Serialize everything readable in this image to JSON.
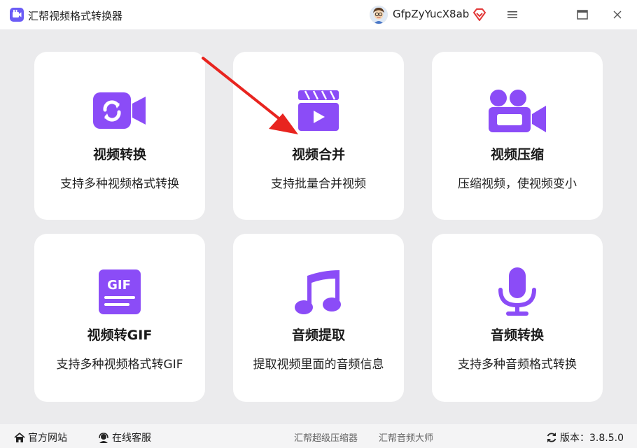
{
  "window": {
    "title": "汇帮视频格式转换器",
    "username": "GfpZyYucX8ab"
  },
  "colors": {
    "accent": "#8b4cf7",
    "arrow": "#e8241f",
    "background": "#ebebed"
  },
  "cards": [
    {
      "title": "视频转换",
      "desc": "支持多种视频格式转换",
      "icon": "video-convert-icon"
    },
    {
      "title": "视频合并",
      "desc": "支持批量合并视频",
      "icon": "clapperboard-icon"
    },
    {
      "title": "视频压缩",
      "desc": "压缩视频，使视频变小",
      "icon": "video-camera-icon"
    },
    {
      "title": "视频转GIF",
      "desc": "支持多种视频格式转GIF",
      "icon": "gif-file-icon"
    },
    {
      "title": "音频提取",
      "desc": "提取视频里面的音频信息",
      "icon": "music-note-icon"
    },
    {
      "title": "音频转换",
      "desc": "支持多种音频格式转换",
      "icon": "microphone-icon"
    }
  ],
  "footer": {
    "official_site": "官方网站",
    "online_service": "在线客服",
    "compressor_link": "汇帮超级压缩器",
    "audio_link": "汇帮音频大师",
    "version": "版本：3.8.5.0"
  }
}
